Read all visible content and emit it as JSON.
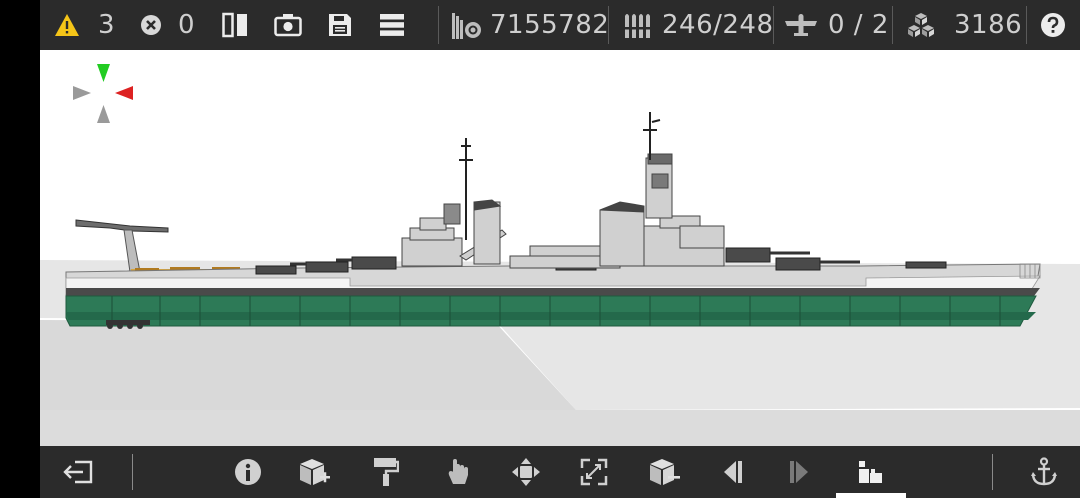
{
  "topbar": {
    "warnings": "3",
    "errors": "0",
    "cost": "7155782",
    "ammo": "246/248",
    "aircraft": "0 / 2",
    "blocks": "3186",
    "icons": [
      "warning-icon",
      "error-icon",
      "mirror-icon",
      "camera-icon",
      "save-icon",
      "menu-icon",
      "cost-icon",
      "ammo-icon",
      "aircraft-icon",
      "blocks-icon",
      "help-icon"
    ]
  },
  "bottombar": {
    "icons": [
      "exit-icon",
      "info-icon",
      "add-block-icon",
      "paint-roller-icon",
      "hand-icon",
      "move-icon",
      "resize-icon",
      "remove-block-icon",
      "previous-icon",
      "next-icon",
      "build-icon",
      "anchor-icon"
    ]
  },
  "colors": {
    "bar_bg": "#2b2b2b",
    "warning": "#f5c518",
    "hull_green": "#2d7a57",
    "gizmo_green": "#22cc22",
    "gizmo_red": "#dd2222",
    "gizmo_gray": "#9a9a9a"
  }
}
